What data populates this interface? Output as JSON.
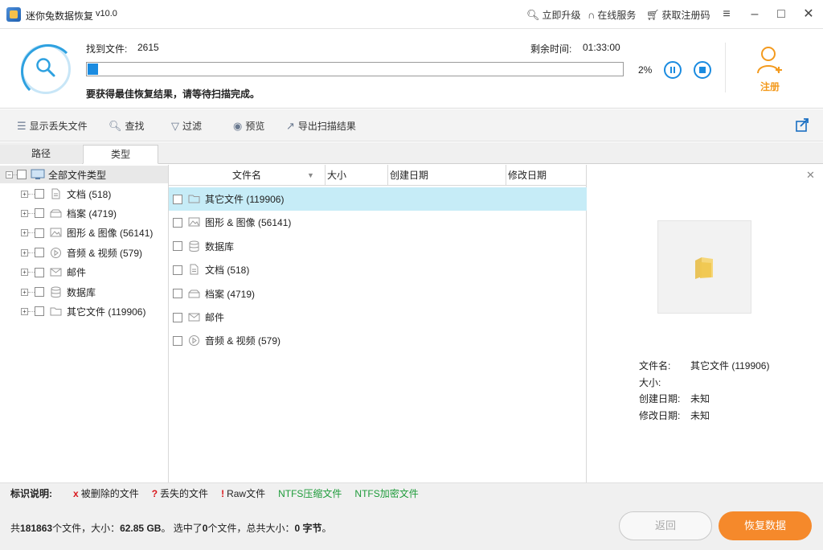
{
  "app": {
    "title": "迷你兔数据恢复",
    "version": "v10.0"
  },
  "titlebar": {
    "upgrade": "立即升级",
    "online_service": "在线服务",
    "get_code": "获取注册码"
  },
  "scan": {
    "found_label": "找到文件:",
    "found_count": "2615",
    "remaining_label": "剩余时间:",
    "remaining_time": "01:33:00",
    "progress_percent": "2%",
    "progress": 0.02,
    "hint": "要获得最佳恢复结果，请等待扫描完成。"
  },
  "register": {
    "label": "注册"
  },
  "toolbar": {
    "show_lost": "显示丢失文件",
    "find": "查找",
    "filter": "过滤",
    "preview": "预览",
    "export": "导出扫描结果"
  },
  "tabs": {
    "path": "路径",
    "type": "类型"
  },
  "tree": {
    "root": "全部文件类型",
    "items": [
      {
        "icon": "document-icon",
        "label": "文档 (518)"
      },
      {
        "icon": "archive-icon",
        "label": "档案 (4719)"
      },
      {
        "icon": "image-icon",
        "label": "图形 & 图像 (56141)"
      },
      {
        "icon": "media-icon",
        "label": "音频 & 视频 (579)"
      },
      {
        "icon": "mail-icon",
        "label": "邮件"
      },
      {
        "icon": "database-icon",
        "label": "数据库"
      },
      {
        "icon": "folder-icon",
        "label": "其它文件 (119906)"
      }
    ]
  },
  "list": {
    "columns": {
      "name": "文件名",
      "size": "大小",
      "created": "创建日期",
      "modified": "修改日期"
    },
    "rows": [
      {
        "icon": "folder-icon",
        "label": "其它文件 (119906)"
      },
      {
        "icon": "image-icon",
        "label": "图形 & 图像 (56141)"
      },
      {
        "icon": "database-icon",
        "label": "数据库"
      },
      {
        "icon": "document-icon",
        "label": "文档 (518)"
      },
      {
        "icon": "archive-icon",
        "label": "档案 (4719)"
      },
      {
        "icon": "mail-icon",
        "label": "邮件"
      },
      {
        "icon": "media-icon",
        "label": "音频 & 视频 (579)"
      }
    ]
  },
  "preview": {
    "name_label": "文件名:",
    "name_value": "其它文件 (119906)",
    "size_label": "大小:",
    "size_value": "",
    "created_label": "创建日期:",
    "created_value": "未知",
    "modified_label": "修改日期:",
    "modified_value": "未知"
  },
  "legend": {
    "title": "标识说明:",
    "deleted_mark": "x",
    "deleted": "被删除的文件",
    "lost_mark": "?",
    "lost": "丢失的文件",
    "raw_mark": "!",
    "raw": "Raw文件",
    "ntfs_compressed": "NTFS压缩文件",
    "ntfs_encrypted": "NTFS加密文件"
  },
  "summary": {
    "prefix": "共",
    "total_files": "181863",
    "files_unit": "个文件，大小：",
    "total_size": "62.85 GB",
    "selected_prefix": "。 选中了",
    "selected_count": "0",
    "selected_mid": "个文件，总共大小：",
    "selected_size": "0 字节",
    "suffix": "。"
  },
  "buttons": {
    "back": "返回",
    "recover": "恢复数据"
  },
  "colors": {
    "accent": "#1a8be0",
    "orange": "#f5892b",
    "selected_row": "#c6ecf7",
    "deleted": "#d9161b",
    "ntfs": "#1e9b3a"
  }
}
